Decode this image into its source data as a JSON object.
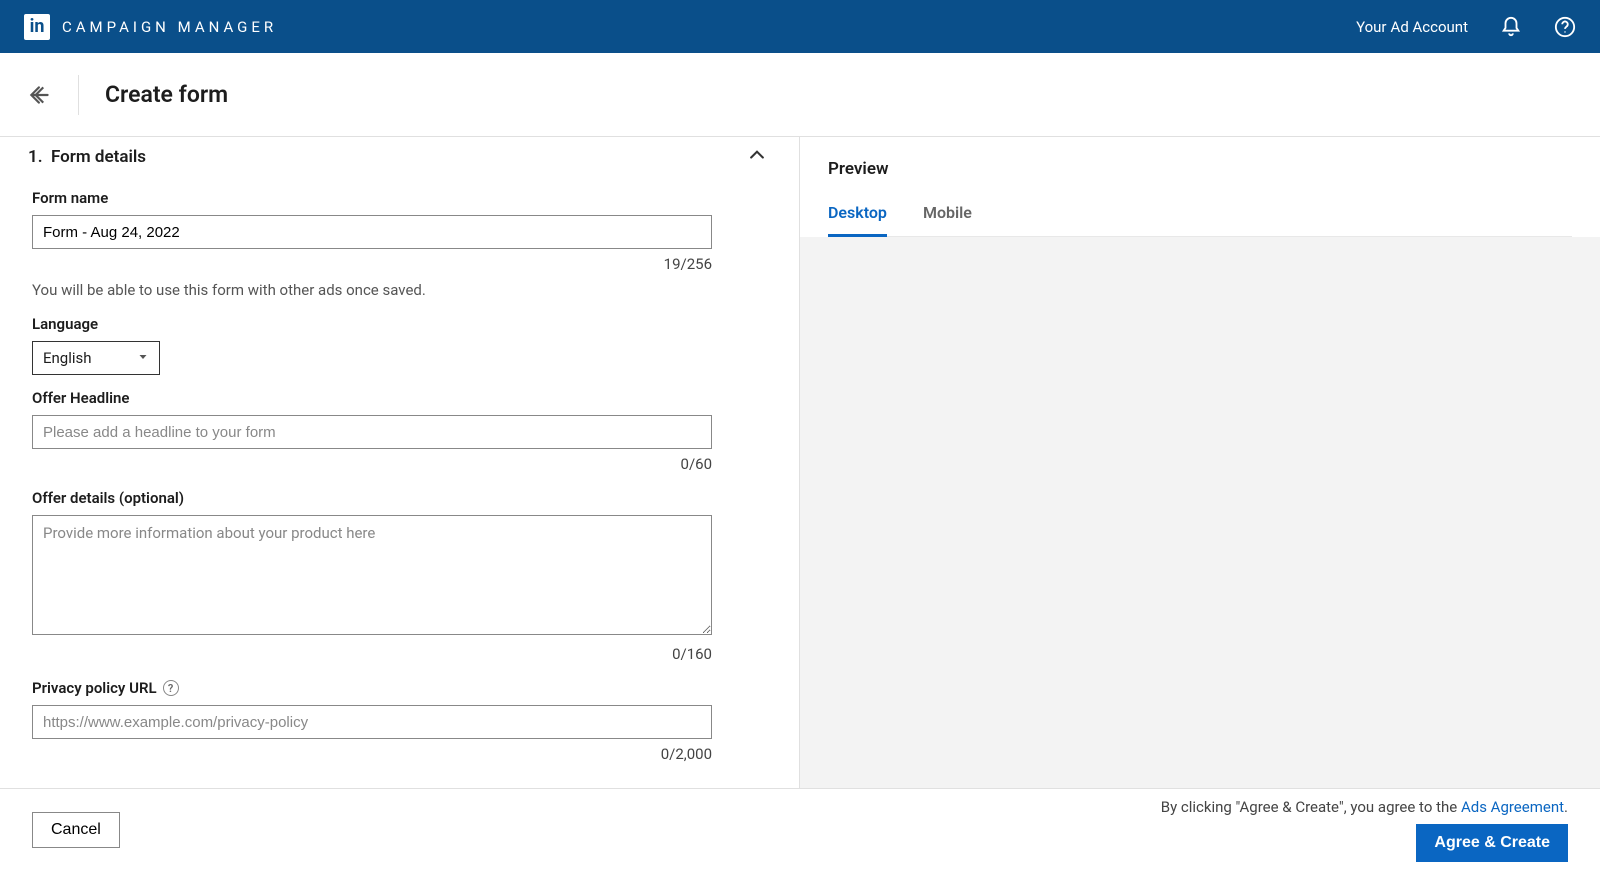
{
  "topbar": {
    "logo_text": "in",
    "brand": "CAMPAIGN MANAGER",
    "account_prefix": "Your",
    "account_label": "Ad Account"
  },
  "page": {
    "title": "Create form"
  },
  "section": {
    "number": "1.",
    "title": "Form details"
  },
  "form": {
    "name_label": "Form name",
    "name_value": "Form - Aug 24, 2022",
    "name_counter": "19/256",
    "name_hint": "You will be able to use this form with other ads once saved.",
    "language_label": "Language",
    "language_value": "English",
    "headline_label": "Offer Headline",
    "headline_placeholder": "Please add a headline to your form",
    "headline_counter": "0/60",
    "details_label": "Offer details (optional)",
    "details_placeholder": "Provide more information about your product here",
    "details_counter": "0/160",
    "privacy_label": "Privacy policy URL",
    "privacy_placeholder": "https://www.example.com/privacy-policy",
    "privacy_counter": "0/2,000"
  },
  "preview": {
    "title": "Preview",
    "tabs": {
      "desktop": "Desktop",
      "mobile": "Mobile"
    }
  },
  "footer": {
    "cancel": "Cancel",
    "disclaimer_prefix": "By clicking \"Agree & Create\", you agree to the ",
    "disclaimer_link": "Ads Agreement",
    "disclaimer_suffix": ".",
    "primary": "Agree & Create"
  }
}
